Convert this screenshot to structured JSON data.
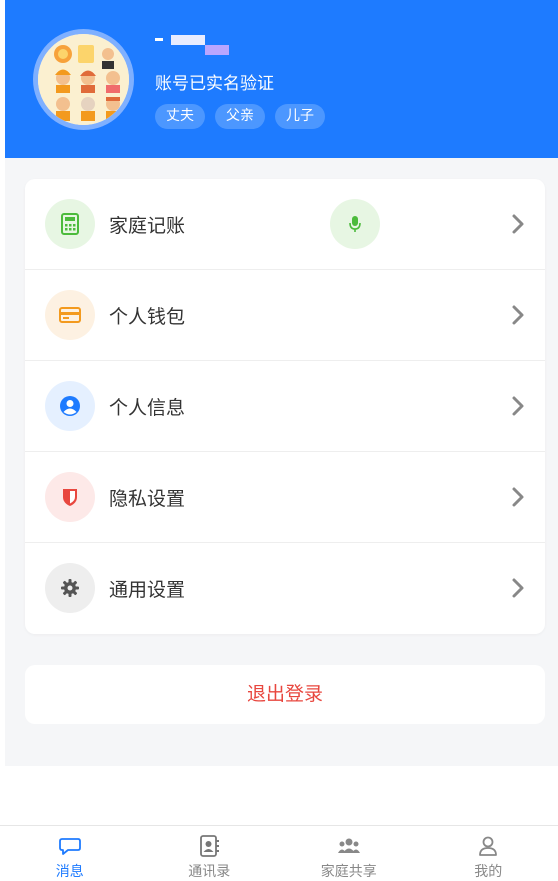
{
  "profile": {
    "verify_text": "账号已实名验证",
    "tags": [
      "丈夫",
      "父亲",
      "儿子"
    ]
  },
  "menu": {
    "items": [
      {
        "label": "家庭记账",
        "icon": "calculator-icon",
        "color": "#4cbb3c"
      },
      {
        "label": "个人钱包",
        "icon": "wallet-icon",
        "color": "#f39a1e"
      },
      {
        "label": "个人信息",
        "icon": "user-circle-icon",
        "color": "#1e7bff"
      },
      {
        "label": "隐私设置",
        "icon": "shield-icon",
        "color": "#e8473f"
      },
      {
        "label": "通用设置",
        "icon": "gear-icon",
        "color": "#555555"
      }
    ],
    "mic_icon": "microphone-icon"
  },
  "logout_label": "退出登录",
  "tabbar": {
    "items": [
      {
        "label": "消息",
        "icon": "chat-bubble-icon",
        "active": true
      },
      {
        "label": "通讯录",
        "icon": "contacts-icon",
        "active": false
      },
      {
        "label": "家庭共享",
        "icon": "group-icon",
        "active": false
      },
      {
        "label": "我的",
        "icon": "person-icon",
        "active": false
      }
    ]
  },
  "colors": {
    "accent": "#1e7bff",
    "danger": "#e8473f"
  }
}
